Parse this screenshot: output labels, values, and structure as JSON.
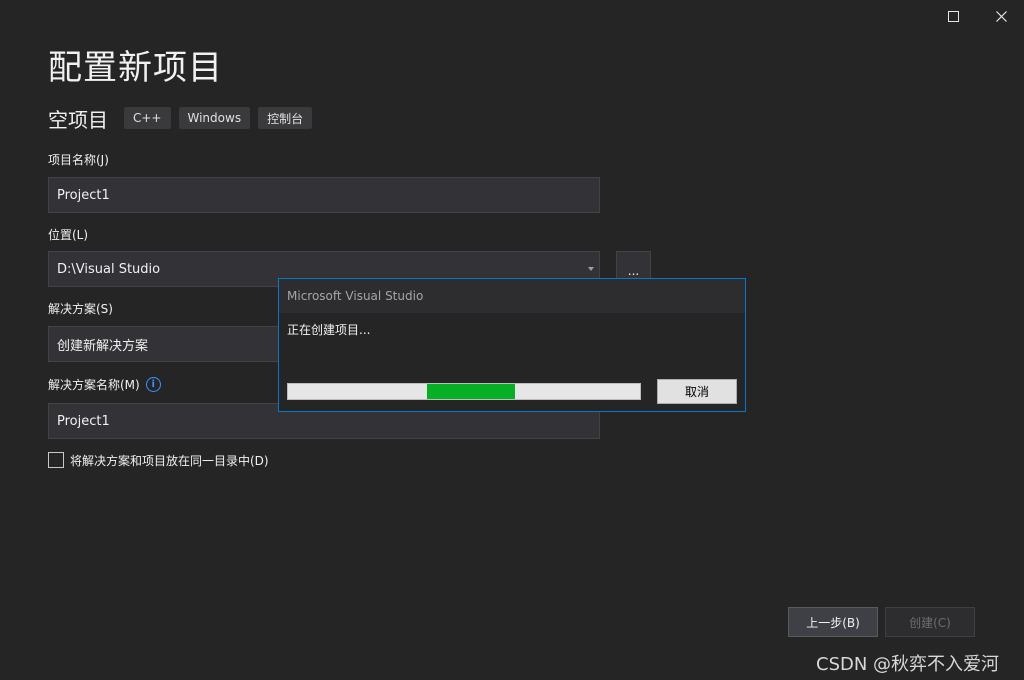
{
  "window": {
    "maximize_icon": "maximize-icon",
    "close_icon": "close-icon"
  },
  "page": {
    "title": "配置新项目",
    "template_name": "空项目",
    "tags": [
      "C++",
      "Windows",
      "控制台"
    ]
  },
  "form": {
    "project_name_label": "项目名称(J)",
    "project_name_value": "Project1",
    "location_label": "位置(L)",
    "location_value": "D:\\Visual Studio",
    "browse_label": "...",
    "solution_label": "解决方案(S)",
    "solution_value": "创建新解决方案",
    "solution_name_label": "解决方案名称(M)",
    "solution_name_info_icon": "info-icon",
    "solution_name_value": "Project1",
    "same_dir_label": "将解决方案和项目放在同一目录中(D)",
    "same_dir_checked": false
  },
  "footer": {
    "back_label": "上一步(B)",
    "create_label": "创建(C)"
  },
  "dialog": {
    "title": "Microsoft Visual Studio",
    "message": "正在创建项目...",
    "progress_start": 0.395,
    "progress_end": 0.645,
    "progress_color": "#06b025",
    "cancel_label": "取消"
  },
  "watermark": "CSDN @秋弈不入爱河",
  "colors": {
    "background": "#252526",
    "accent": "#007acc",
    "info": "#3794ff"
  }
}
